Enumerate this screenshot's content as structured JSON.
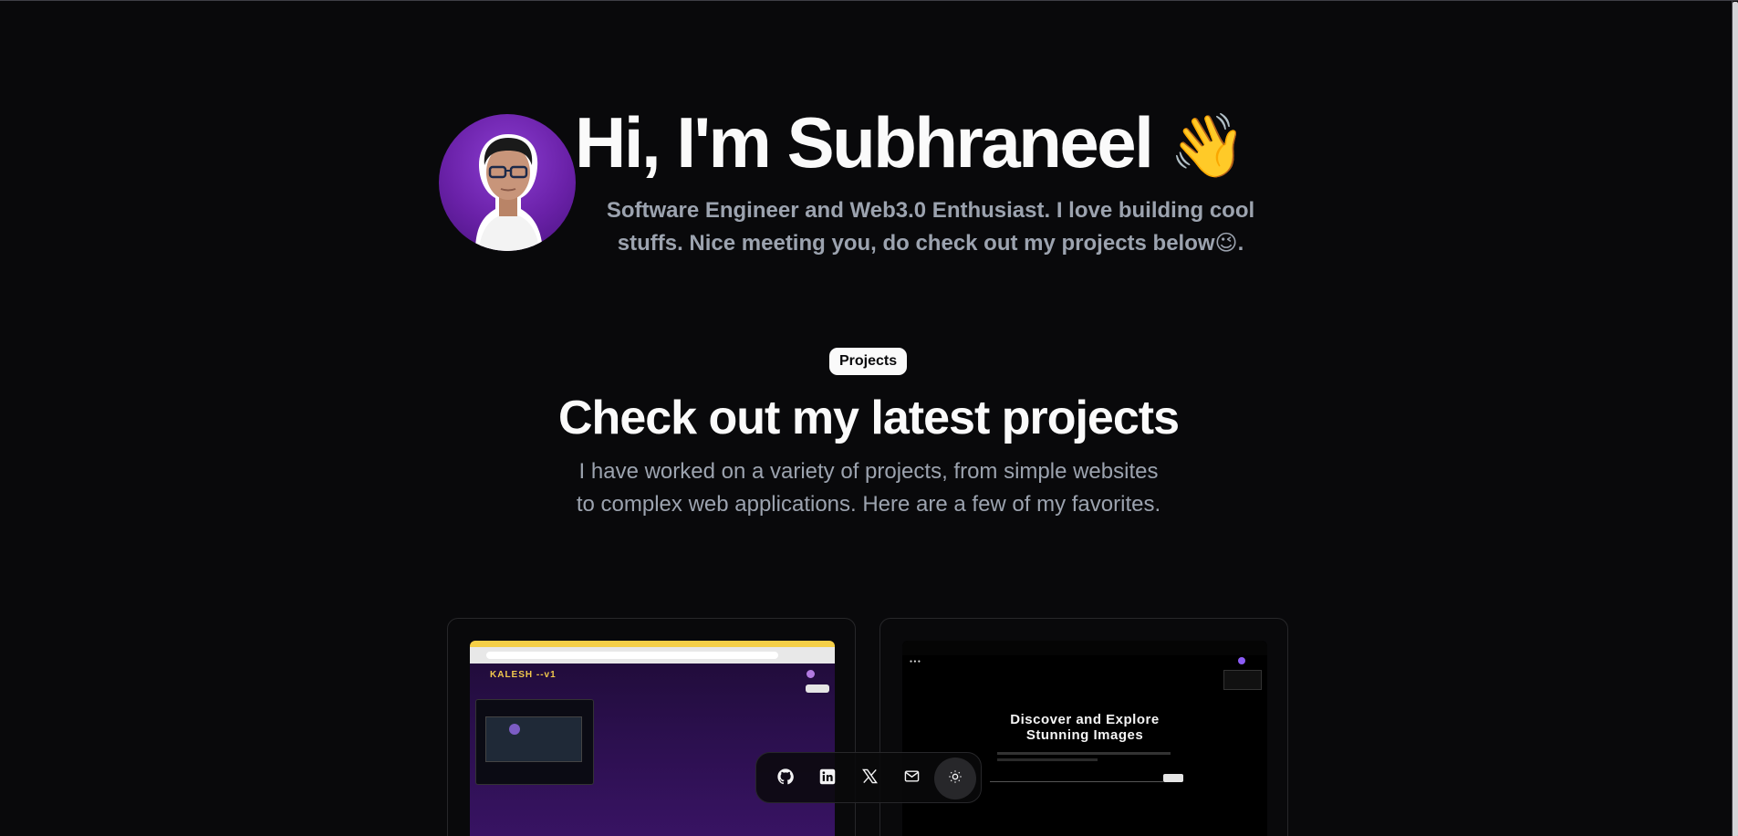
{
  "hero": {
    "title": "Hi, I'm Subhraneel",
    "wave_emoji": "👋",
    "subtitle": "Software Engineer and Web3.0 Enthusiast. I love building cool stuffs. Nice meeting you, do check out my projects below😉."
  },
  "projects": {
    "badge": "Projects",
    "title": "Check out my latest projects",
    "description": "I have worked on a variety of projects, from simple websites to complex web applications. Here are a few of my favorites."
  },
  "cards": [
    {
      "brand": "KALESH --v1"
    },
    {
      "headline_line1": "Discover and Explore",
      "headline_line2": "Stunning Images"
    }
  ],
  "dock": {
    "icons": [
      "github-icon",
      "linkedin-icon",
      "x-icon",
      "mail-icon",
      "sun-icon"
    ]
  },
  "colors": {
    "background": "#09090b",
    "text": "#fafafa",
    "muted": "#9ca3af",
    "avatar_bg": "#6a21a8",
    "kalesh_accent": "#f2c94c"
  }
}
